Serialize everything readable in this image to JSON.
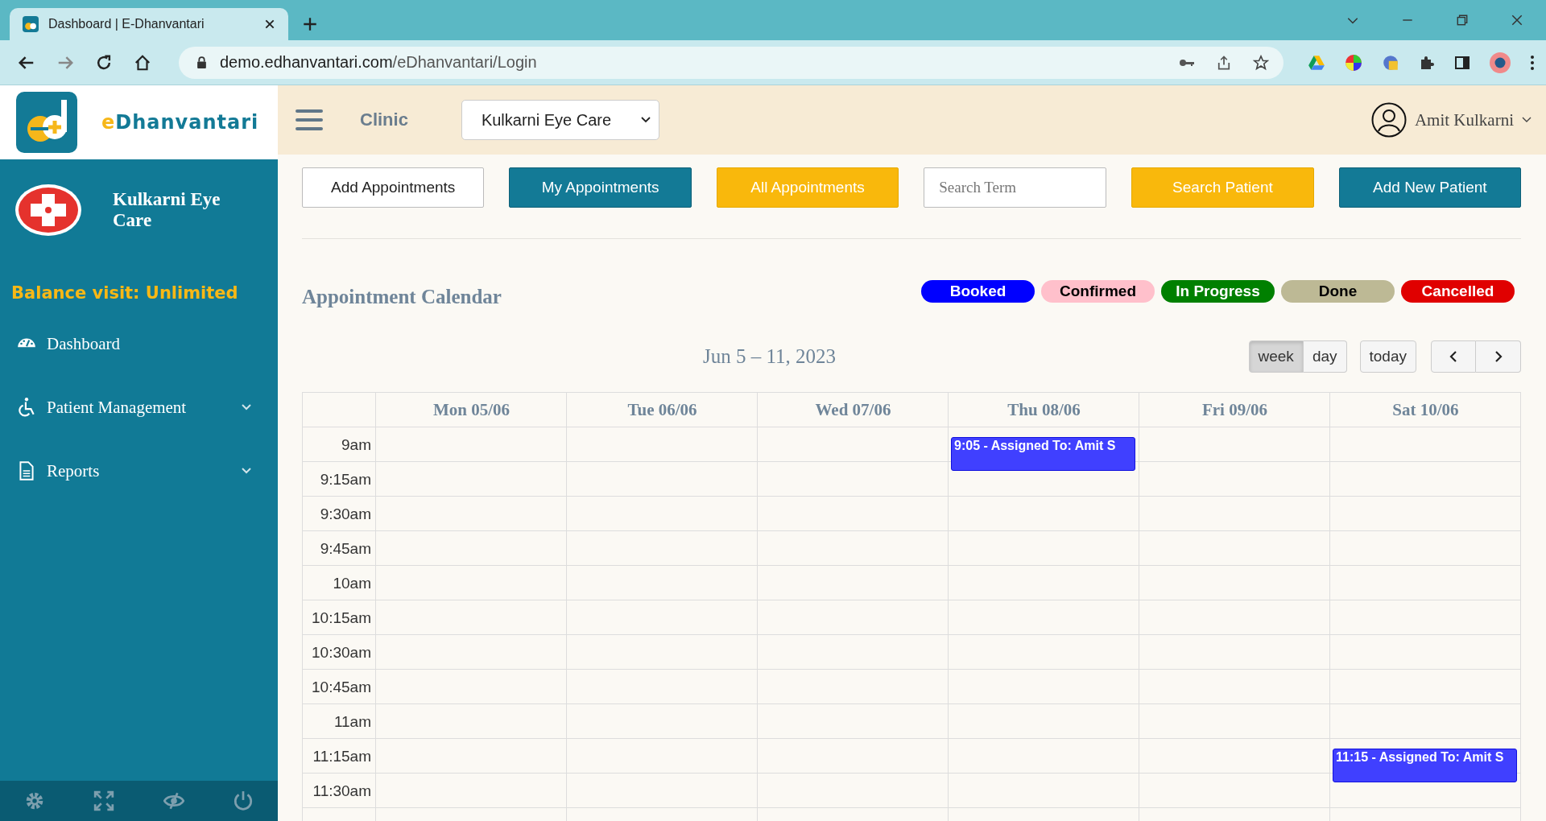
{
  "browser": {
    "tab_title": "Dashboard | E-Dhanvantari",
    "url_host": "demo.edhanvantari.com",
    "url_path": "/eDhanvantari/Login"
  },
  "sidebar": {
    "brand": "eDhanvantari",
    "clinic_name": "Kulkarni Eye Care",
    "balance": "Balance visit: Unlimited",
    "items": [
      {
        "label": "Dashboard",
        "kind": "link"
      },
      {
        "label": "Patient Management",
        "kind": "group",
        "expanded": false
      },
      {
        "label": "Reports",
        "kind": "group",
        "expanded": false
      }
    ]
  },
  "header": {
    "section": "Clinic",
    "clinic_select": "Kulkarni Eye Care",
    "user": "Amit Kulkarni"
  },
  "toolbar": [
    {
      "label": "Add Appointments",
      "kind": "outline"
    },
    {
      "label": "My Appointments",
      "kind": "teal"
    },
    {
      "label": "All Appointments",
      "kind": "yellow"
    },
    {
      "placeholder": "Search Term",
      "kind": "field"
    },
    {
      "label": "Search Patient",
      "kind": "yellow"
    },
    {
      "label": "Add New Patient",
      "kind": "teal"
    }
  ],
  "calendar": {
    "title": "Appointment Calendar",
    "legend": [
      {
        "label": "Booked",
        "color": "#0000ff"
      },
      {
        "label": "Confirmed",
        "color": "#ffc0cb"
      },
      {
        "label": "In Progress",
        "color": "#008000"
      },
      {
        "label": "Done",
        "color": "#bdb995"
      },
      {
        "label": "Cancelled",
        "color": "#e00000"
      }
    ],
    "range": "Jun 5 – 11, 2023",
    "views": [
      {
        "label": "week",
        "selected": true
      },
      {
        "label": "day",
        "selected": false
      }
    ],
    "today": "today",
    "columns": [
      "Mon 05/06",
      "Tue 06/06",
      "Wed 07/06",
      "Thu 08/06",
      "Fri 09/06",
      "Sat 10/06"
    ],
    "rows": [
      {
        "time": "9am",
        "cells": [
          null,
          null,
          null,
          {
            "event": "9:05 - Assigned To: Amit S",
            "color": "#4040ff"
          },
          null,
          null
        ]
      },
      {
        "time": "9:15am"
      },
      {
        "time": "9:30am"
      },
      {
        "time": "9:45am"
      },
      {
        "time": "10am"
      },
      {
        "time": "10:15am"
      },
      {
        "time": "10:30am"
      },
      {
        "time": "10:45am"
      },
      {
        "time": "11am"
      },
      {
        "time": "11:15am",
        "cells": [
          null,
          null,
          null,
          null,
          null,
          {
            "event": "11:15 - Assigned To: Amit S",
            "color": "#4040ff"
          }
        ]
      },
      {
        "time": "11:30am"
      }
    ]
  }
}
